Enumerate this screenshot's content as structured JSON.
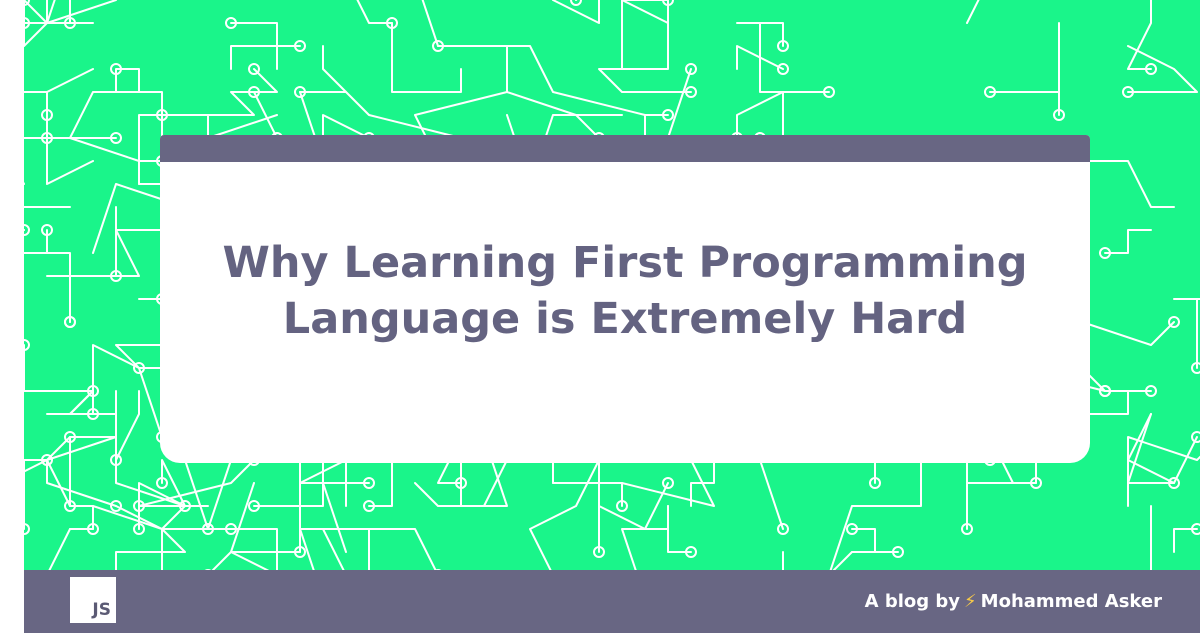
{
  "card": {
    "title": "Why Learning First Programming Language is Extremely Hard"
  },
  "footer": {
    "logo_text": "JS",
    "byline_prefix": "A blog by",
    "bolt_glyph": "⚡",
    "author": "Mohammed Asker"
  },
  "colors": {
    "background_green": "#1af58a",
    "circuit_lines": "#ffffff",
    "accent_slate": "#686683",
    "title_text": "#646381",
    "bolt": "#f7c948"
  },
  "icons": {
    "logo": "js-logo-icon",
    "bolt": "lightning-bolt-icon"
  }
}
